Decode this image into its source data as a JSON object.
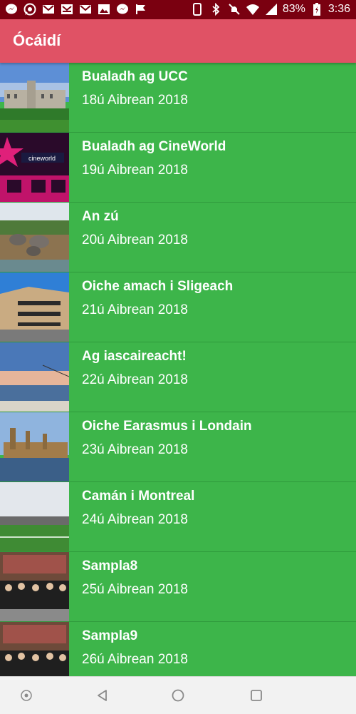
{
  "status_bar": {
    "battery": "83%",
    "time": "3:36",
    "icons": [
      "messenger-icon",
      "whatsapp-icon",
      "gmail-icon",
      "inbox-icon",
      "gmail-icon",
      "image-icon",
      "messenger-icon",
      "flag-icon",
      "phone-icon",
      "bluetooth-icon",
      "mute-icon",
      "wifi-icon",
      "signal-icon",
      "battery-icon"
    ]
  },
  "app_bar": {
    "title": "Ócáidí",
    "color": "#e05265"
  },
  "list": {
    "background": "#3db54a",
    "items": [
      {
        "title": "Bualadh ag UCC",
        "date": "18ú Aibrean 2018",
        "thumb": "ucc-photo"
      },
      {
        "title": "Bualadh ag CineWorld",
        "date": "19ú Aibrean 2018",
        "thumb": "cineworld-photo"
      },
      {
        "title": "An zú",
        "date": "20ú Aibrean 2018",
        "thumb": "zoo-photo"
      },
      {
        "title": "Oiche amach i Sligeach",
        "date": "21ú Aibrean 2018",
        "thumb": "sligo-photo"
      },
      {
        "title": "Ag iascaireacht!",
        "date": "22ú Aibrean 2018",
        "thumb": "fishing-photo"
      },
      {
        "title": "Oiche Earasmus i Londain",
        "date": "23ú Aibrean 2018",
        "thumb": "london-photo"
      },
      {
        "title": "Camán i Montreal",
        "date": "24ú Aibrean 2018",
        "thumb": "montreal-photo"
      },
      {
        "title": "Sampla8",
        "date": "25ú Aibrean 2018",
        "thumb": "group-photo"
      },
      {
        "title": "Sampla9",
        "date": "26ú Aibrean 2018",
        "thumb": "group-photo"
      }
    ]
  }
}
